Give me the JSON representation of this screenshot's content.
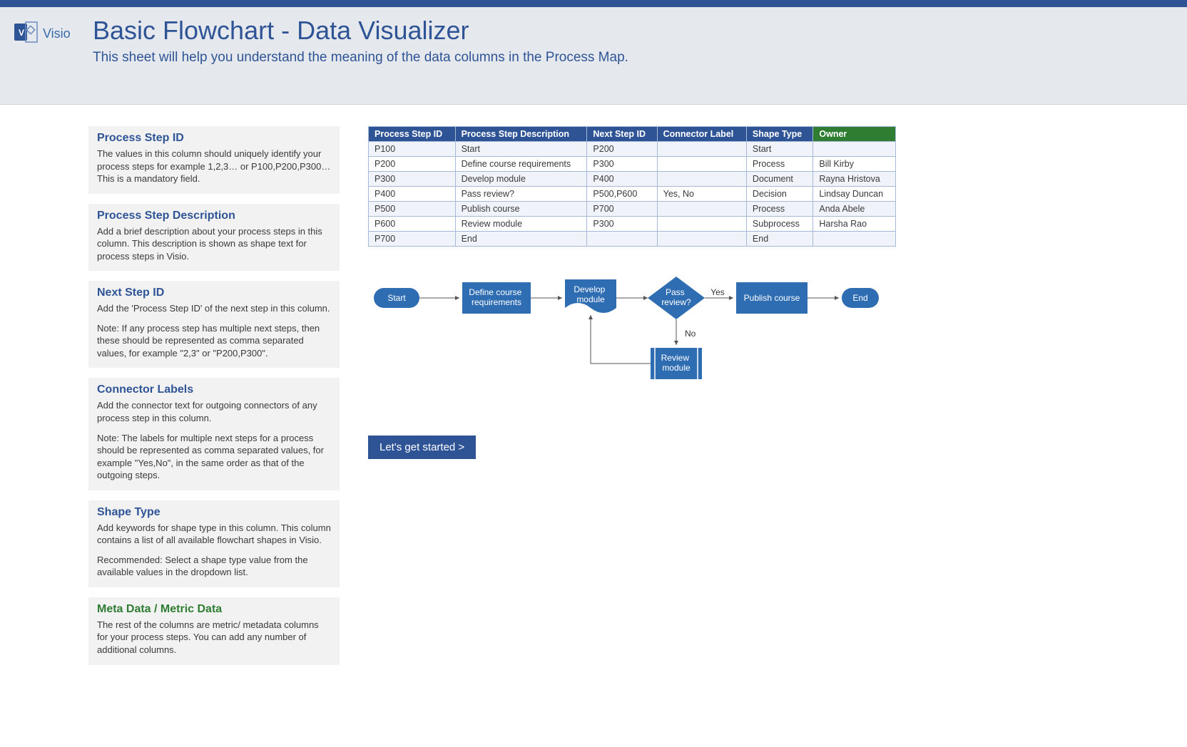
{
  "app": {
    "name": "Visio"
  },
  "header": {
    "title": "Basic Flowchart - Data Visualizer",
    "subtitle": "This sheet will help you understand the meaning of the data columns in the Process Map."
  },
  "sections": [
    {
      "title": "Process Step ID",
      "paras": [
        "The values in this column should uniquely identify your process steps for example 1,2,3… or P100,P200,P300… This is a mandatory field."
      ]
    },
    {
      "title": "Process Step Description",
      "paras": [
        "Add a brief description about your process steps in this column. This description is shown as shape text for process steps in Visio."
      ]
    },
    {
      "title": "Next Step ID",
      "paras": [
        "Add the 'Process Step ID' of the next step in this column.",
        "Note: If any process step has multiple next steps, then these should be represented as comma separated values, for example \"2,3\" or \"P200,P300\"."
      ]
    },
    {
      "title": "Connector Labels",
      "paras": [
        "Add the connector text for outgoing connectors of any process step in this column.",
        "Note: The labels for multiple next steps for a process should be represented as comma separated values, for example \"Yes,No\", in the same order as that of the outgoing steps."
      ]
    },
    {
      "title": "Shape Type",
      "paras": [
        "Add keywords for shape type in this column. This column contains a list of all available flowchart shapes in Visio.",
        "Recommended: Select a shape type value from the available values in the dropdown list."
      ]
    },
    {
      "title": "Meta Data / Metric Data",
      "green": true,
      "paras": [
        "The rest of the columns are metric/ metadata columns for your process steps. You can add any number of additional columns."
      ]
    }
  ],
  "table": {
    "headers": [
      "Process Step ID",
      "Process Step Description",
      "Next Step ID",
      "Connector Label",
      "Shape Type",
      "Owner"
    ],
    "rows": [
      [
        "P100",
        "Start",
        "P200",
        "",
        "Start",
        ""
      ],
      [
        "P200",
        "Define course requirements",
        "P300",
        "",
        "Process",
        "Bill Kirby"
      ],
      [
        "P300",
        "Develop module",
        "P400",
        "",
        "Document",
        "Rayna Hristova"
      ],
      [
        "P400",
        "Pass review?",
        "P500,P600",
        "Yes, No",
        "Decision",
        "Lindsay Duncan"
      ],
      [
        "P500",
        "Publish course",
        "P700",
        "",
        "Process",
        "Anda Abele"
      ],
      [
        "P600",
        "Review module",
        "P300",
        "",
        "Subprocess",
        "Harsha Rao"
      ],
      [
        "P700",
        "End",
        "",
        "",
        "End",
        ""
      ]
    ]
  },
  "flow": {
    "start": "Start",
    "define": "Define course requirements",
    "develop": "Develop module",
    "decision": "Pass review?",
    "yes": "Yes",
    "no": "No",
    "publish": "Publish course",
    "review": "Review module",
    "end": "End"
  },
  "cta": "Let's get started >"
}
